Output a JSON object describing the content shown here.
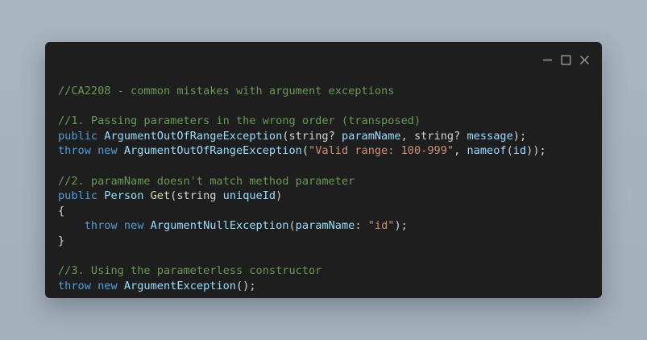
{
  "window": {
    "controls": {
      "minimize": "minimize-icon",
      "maximize": "maximize-icon",
      "close": "close-icon"
    }
  },
  "code": {
    "lines": [
      [
        {
          "t": "//CA2208 - common mistakes with argument exceptions",
          "c": "cm"
        }
      ],
      [],
      [
        {
          "t": "//1. Passing parameters in the wrong order (transposed)",
          "c": "cm"
        }
      ],
      [
        {
          "t": "public",
          "c": "kw"
        },
        {
          "t": " ",
          "c": "pl"
        },
        {
          "t": "ArgumentOutOfRangeException",
          "c": "cl"
        },
        {
          "t": "(string? ",
          "c": "pl"
        },
        {
          "t": "paramName",
          "c": "cl"
        },
        {
          "t": ", string? ",
          "c": "pl"
        },
        {
          "t": "message",
          "c": "cl"
        },
        {
          "t": ");",
          "c": "pl"
        }
      ],
      [
        {
          "t": "throw",
          "c": "kw"
        },
        {
          "t": " ",
          "c": "pl"
        },
        {
          "t": "new",
          "c": "kw"
        },
        {
          "t": " ",
          "c": "pl"
        },
        {
          "t": "ArgumentOutOfRangeException",
          "c": "cl"
        },
        {
          "t": "(",
          "c": "pl"
        },
        {
          "t": "\"Valid range: 100-999\"",
          "c": "st"
        },
        {
          "t": ", ",
          "c": "pl"
        },
        {
          "t": "nameof",
          "c": "cl"
        },
        {
          "t": "(",
          "c": "pl"
        },
        {
          "t": "id",
          "c": "cl"
        },
        {
          "t": "));",
          "c": "pl"
        }
      ],
      [],
      [
        {
          "t": "//2. paramName doesn't match method parameter",
          "c": "cm"
        }
      ],
      [
        {
          "t": "public",
          "c": "kw"
        },
        {
          "t": " ",
          "c": "pl"
        },
        {
          "t": "Person",
          "c": "cl"
        },
        {
          "t": " ",
          "c": "pl"
        },
        {
          "t": "Get",
          "c": "fn"
        },
        {
          "t": "(string ",
          "c": "pl"
        },
        {
          "t": "uniqueId",
          "c": "cl"
        },
        {
          "t": ")",
          "c": "pl"
        }
      ],
      [
        {
          "t": "{",
          "c": "pl"
        }
      ],
      [
        {
          "t": "    ",
          "c": "pl"
        },
        {
          "t": "throw",
          "c": "kw"
        },
        {
          "t": " ",
          "c": "pl"
        },
        {
          "t": "new",
          "c": "kw"
        },
        {
          "t": " ",
          "c": "pl"
        },
        {
          "t": "ArgumentNullException",
          "c": "cl"
        },
        {
          "t": "(",
          "c": "pl"
        },
        {
          "t": "paramName",
          "c": "cl"
        },
        {
          "t": ": ",
          "c": "pl"
        },
        {
          "t": "\"id\"",
          "c": "st"
        },
        {
          "t": ");",
          "c": "pl"
        }
      ],
      [
        {
          "t": "}",
          "c": "pl"
        }
      ],
      [],
      [
        {
          "t": "//3. Using the parameterless constructor",
          "c": "cm"
        }
      ],
      [
        {
          "t": "throw",
          "c": "kw"
        },
        {
          "t": " ",
          "c": "pl"
        },
        {
          "t": "new",
          "c": "kw"
        },
        {
          "t": " ",
          "c": "pl"
        },
        {
          "t": "ArgumentException",
          "c": "cl"
        },
        {
          "t": "();",
          "c": "pl"
        }
      ]
    ]
  }
}
